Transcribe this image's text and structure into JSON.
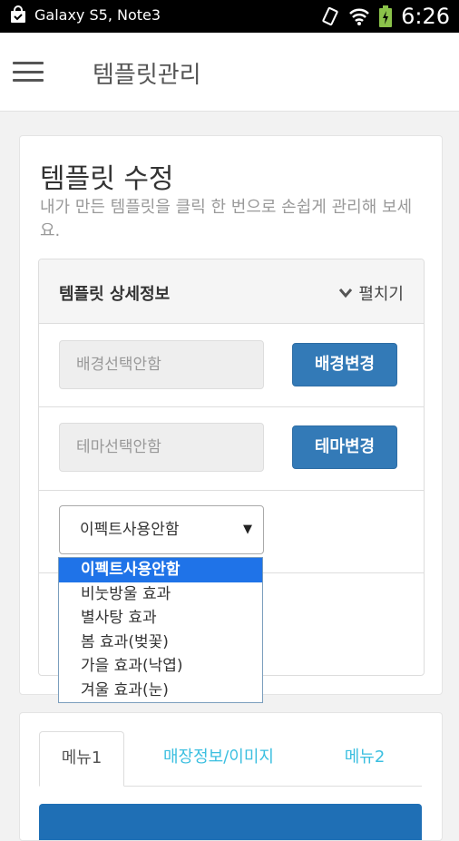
{
  "status_bar": {
    "notification_text": "Galaxy S5, Note3",
    "time": "6:26"
  },
  "app_bar": {
    "title": "템플릿관리"
  },
  "header": {
    "title": "템플릿 수정",
    "subtitle": "내가 만든 템플릿을 클릭 한 번으로 손쉽게 관리해 보세요."
  },
  "panel": {
    "title": "템플릿 상세정보",
    "toggle_label": "펼치기",
    "background_field": "배경선택안함",
    "background_button": "배경변경",
    "theme_field": "테마선택안함",
    "theme_button": "테마변경",
    "effect_select": "이펙트사용안함"
  },
  "effect_options": [
    "이펙트사용안함",
    "비눗방울 효과",
    "별사탕 효과",
    "봄 효과(벚꽃)",
    "가을 효과(낙엽)",
    "겨울 효과(눈)"
  ],
  "tabs": [
    "메뉴1",
    "매장정보/이미지",
    "메뉴2"
  ],
  "colors": {
    "primary_button": "#337ab7",
    "selected_option": "#1f73e8",
    "tab_link": "#3bbfe0"
  }
}
